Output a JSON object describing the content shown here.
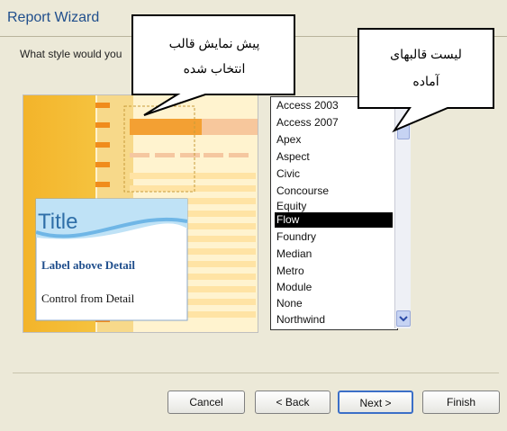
{
  "window": {
    "title": "Report Wizard"
  },
  "prompt": "What style would you",
  "preview": {
    "title": "Title",
    "label": "Label above Detail",
    "control": "Control from Detail"
  },
  "styles": {
    "items": [
      "Access 2003",
      "Access 2007",
      "Apex",
      "Aspect",
      "Civic",
      "Concourse",
      "Equity",
      "Flow",
      "Foundry",
      "Median",
      "Metro",
      "Module",
      "None",
      "Northwind"
    ],
    "selected": "Flow"
  },
  "callouts": {
    "preview_line1": "پیش نمایش قالب",
    "preview_line2": "انتخاب شده",
    "list_line1": "لیست قالبهای",
    "list_line2": "آماده"
  },
  "buttons": {
    "cancel": "Cancel",
    "back": "< Back",
    "next": "Next >",
    "finish": "Finish"
  },
  "colors": {
    "title_blue": "#1f4e8c",
    "preview_orange": "#f6ce44",
    "selection": "#000000"
  }
}
